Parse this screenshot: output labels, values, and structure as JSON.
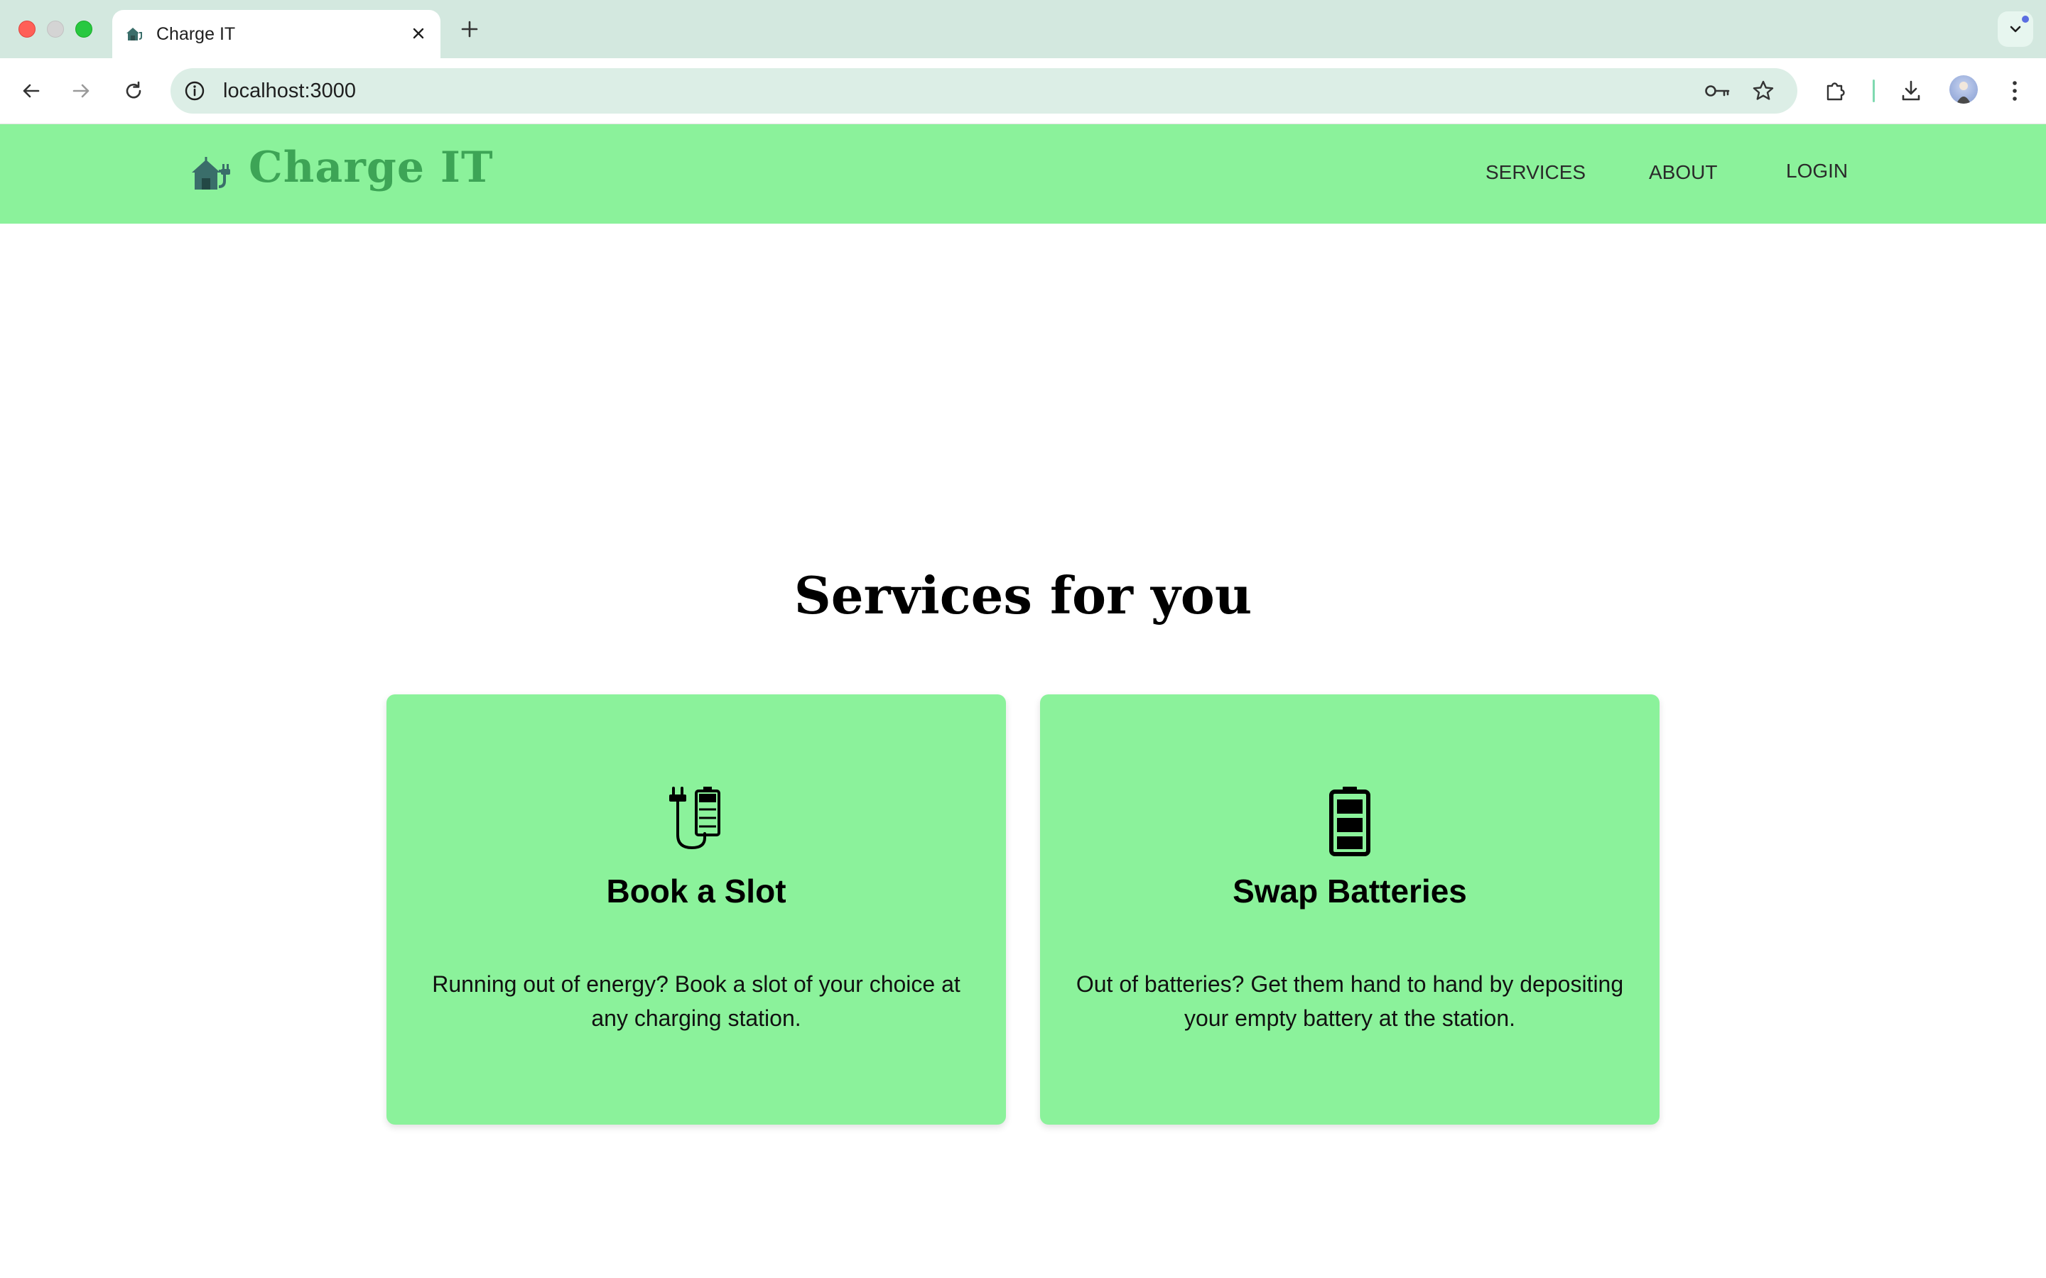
{
  "browser": {
    "tab": {
      "title": "Charge IT",
      "favicon": "charging-house-favicon"
    },
    "address_bar": {
      "url": "localhost:3000"
    },
    "icons": {
      "back": "arrow-left-icon",
      "forward": "arrow-right-icon",
      "reload": "reload-icon",
      "site_info": "info-icon",
      "password_key": "key-icon",
      "bookmark": "star-icon",
      "extensions": "puzzle-icon",
      "downloads": "download-icon",
      "menu": "kebab-menu-icon"
    }
  },
  "site": {
    "brand": "Charge IT",
    "brand_color": "#3da456",
    "header_bg": "#8bf29b",
    "nav": [
      "SERVICES",
      "ABOUT",
      "LOGIN"
    ]
  },
  "services": {
    "title": "Services for you",
    "cards": [
      {
        "icon": "plug-battery-icon",
        "title": "Book a Slot",
        "description": "Running out of energy? Book a slot of your choice at any charging station."
      },
      {
        "icon": "battery-icon",
        "title": "Swap Batteries",
        "description": "Out of batteries? Get them hand to hand by depositing your empty battery at the station."
      }
    ]
  }
}
